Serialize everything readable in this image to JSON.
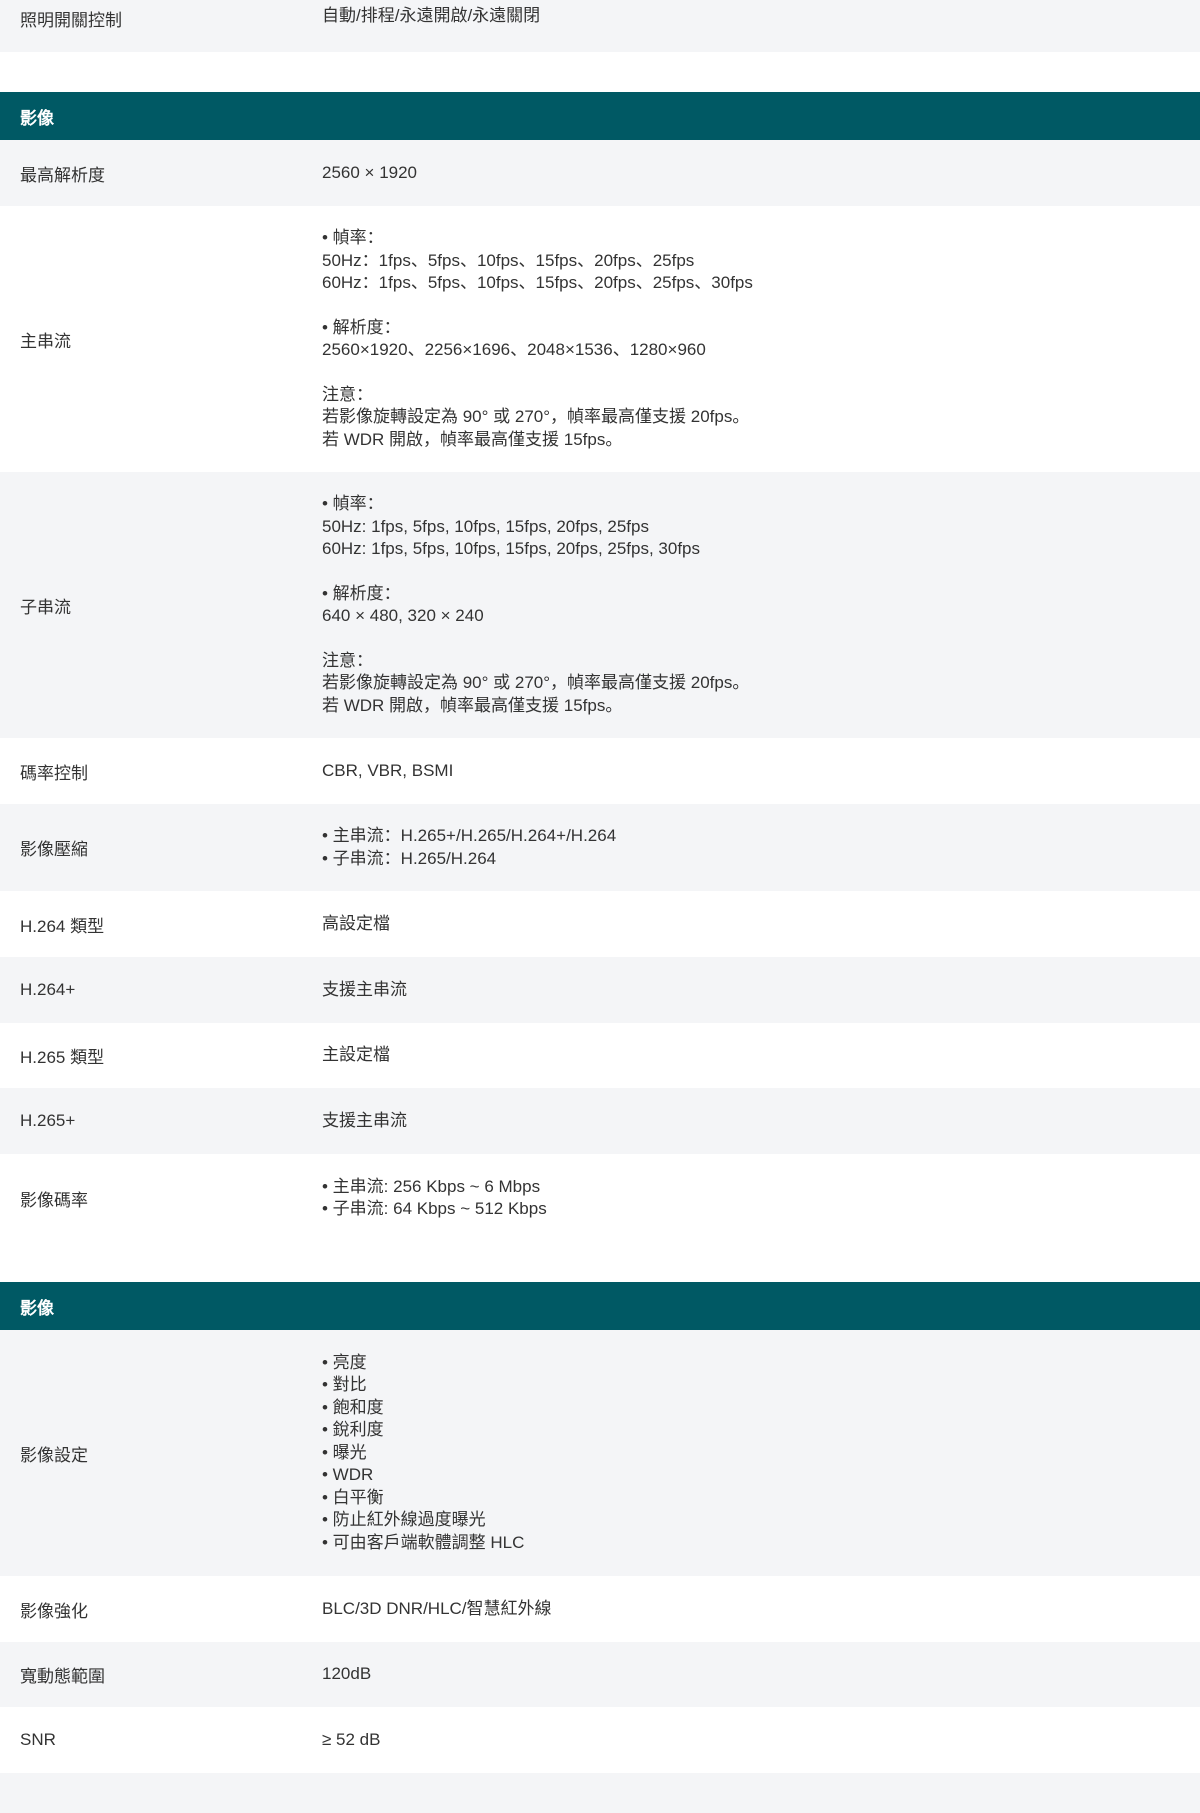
{
  "rows_top": [
    {
      "label": "照明開關控制",
      "lines": [
        "自動/排程/永遠開啟/永遠關閉"
      ]
    }
  ],
  "sections": [
    {
      "title": "影像",
      "rows": [
        {
          "label": "最高解析度",
          "lines": [
            "2560 × 1920"
          ]
        },
        {
          "label": "主串流",
          "lines": [
            "• 幀率：",
            "50Hz：1fps、5fps、10fps、15fps、20fps、25fps",
            "60Hz：1fps、5fps、10fps、15fps、20fps、25fps、30fps",
            "",
            "• 解析度：",
            "2560×1920、2256×1696、2048×1536、1280×960",
            "",
            "注意：",
            "若影像旋轉設定為 90° 或 270°，幀率最高僅支援 20fps。",
            "若 WDR 開啟，幀率最高僅支援 15fps。"
          ]
        },
        {
          "label": "子串流",
          "lines": [
            "• 幀率：",
            "50Hz: 1fps, 5fps, 10fps, 15fps, 20fps, 25fps",
            "60Hz: 1fps, 5fps, 10fps, 15fps, 20fps, 25fps, 30fps",
            "",
            "• 解析度：",
            "640 × 480, 320 × 240",
            "",
            "注意：",
            "若影像旋轉設定為 90° 或 270°，幀率最高僅支援 20fps。",
            "若 WDR 開啟，幀率最高僅支援 15fps。"
          ]
        },
        {
          "label": "碼率控制",
          "lines": [
            "CBR, VBR, BSMI"
          ]
        },
        {
          "label": "影像壓縮",
          "lines": [
            "• 主串流：H.265+/H.265/H.264+/H.264",
            "• 子串流：H.265/H.264"
          ]
        },
        {
          "label": "H.264 類型",
          "lines": [
            "高設定檔"
          ]
        },
        {
          "label": "H.264+",
          "lines": [
            "支援主串流"
          ]
        },
        {
          "label": "H.265 類型",
          "lines": [
            "主設定檔"
          ]
        },
        {
          "label": "H.265+",
          "lines": [
            "支援主串流"
          ]
        },
        {
          "label": "影像碼率",
          "lines": [
            "• 主串流: 256 Kbps ~ 6 Mbps",
            "• 子串流: 64 Kbps ~ 512 Kbps"
          ]
        }
      ]
    },
    {
      "title": "影像",
      "rows": [
        {
          "label": "影像設定",
          "lines": [
            "• 亮度",
            "• 對比",
            "• 飽和度",
            "• 銳利度",
            "• 曝光",
            "• WDR",
            "• 白平衡",
            "• 防止紅外線過度曝光",
            "• 可由客戶端軟體調整 HLC"
          ]
        },
        {
          "label": "影像強化",
          "lines": [
            "BLC/3D DNR/HLC/智慧紅外線"
          ]
        },
        {
          "label": "寬動態範圍",
          "lines": [
            "120dB"
          ]
        },
        {
          "label": "SNR",
          "lines": [
            "≥ 52 dB"
          ]
        }
      ]
    }
  ]
}
